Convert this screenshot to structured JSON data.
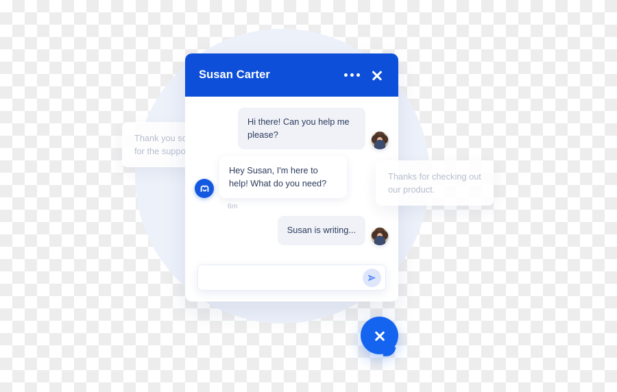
{
  "widget": {
    "header": {
      "title": "Susan Carter",
      "more_icon": "more-options-dots-icon",
      "close_icon": "close-icon",
      "background_color": "#0d4fd8"
    },
    "messages": [
      {
        "id": "msg-1",
        "direction": "incoming",
        "text": "Hi there! Can you help me please?",
        "bubble_style": "grey",
        "avatar": "user-avatar-photo"
      },
      {
        "id": "msg-2",
        "direction": "outgoing",
        "text": "Hey Susan, I'm here to help! What do you need?",
        "bubble_style": "white",
        "avatar": "bot-avatar-logo",
        "timestamp": "6m"
      },
      {
        "id": "msg-3",
        "direction": "incoming",
        "text": "Susan is writing...",
        "bubble_style": "grey",
        "avatar": "user-avatar-photo"
      }
    ],
    "composer": {
      "value": "",
      "placeholder": "",
      "send_icon": "send-paper-plane-icon",
      "send_icon_color": "#5b8df5",
      "send_button_background": "#dde6fb"
    }
  },
  "floating_cards": [
    {
      "id": "card-left",
      "text": "Thank you so much for the support!"
    },
    {
      "id": "card-right",
      "text": "Thanks for checking out our product."
    }
  ],
  "launcher": {
    "icon": "close-icon",
    "shape": "chat-bubble",
    "color": "#1564ef"
  },
  "decor": {
    "circle_color": "#edf1fa"
  }
}
